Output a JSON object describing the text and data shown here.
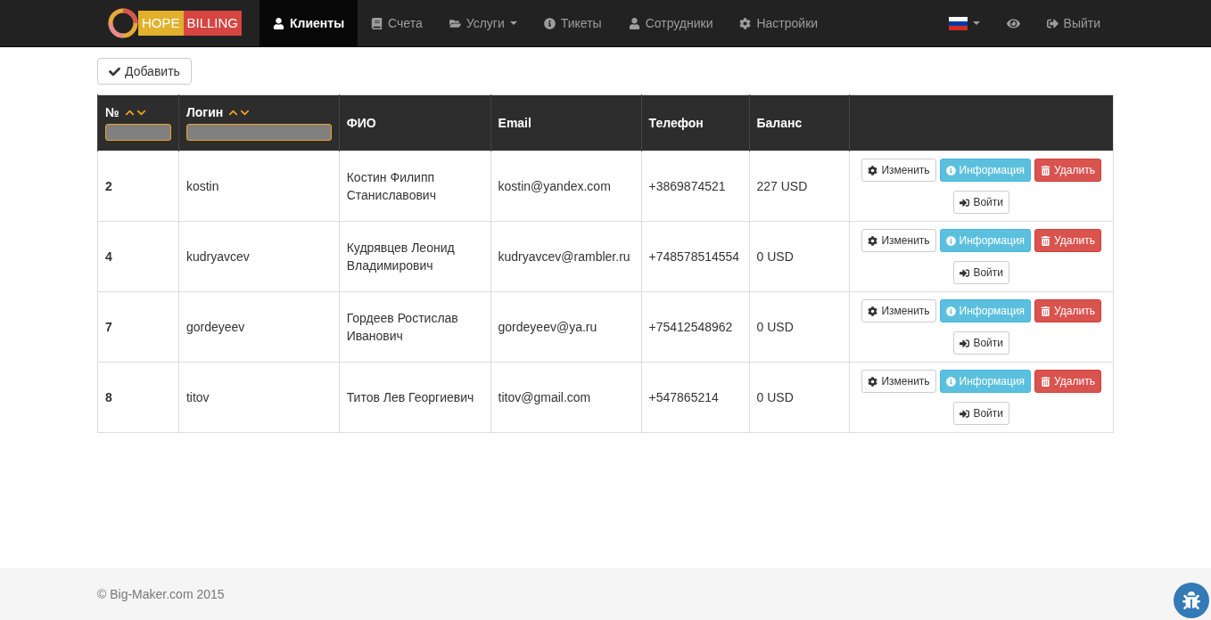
{
  "brand": {
    "left": "HOPE",
    "right": "BILLING"
  },
  "nav": [
    {
      "label": "Клиенты",
      "selected": true,
      "dropdown": false
    },
    {
      "label": "Счета",
      "selected": false,
      "dropdown": false
    },
    {
      "label": "Услуги",
      "selected": false,
      "dropdown": true
    },
    {
      "label": "Тикеты",
      "selected": false,
      "dropdown": false
    },
    {
      "label": "Сотрудники",
      "selected": false,
      "dropdown": false
    },
    {
      "label": "Настройки",
      "selected": false,
      "dropdown": false
    }
  ],
  "logout": "Выйти",
  "add_button": "Добавить",
  "table": {
    "columns": [
      {
        "label": "№",
        "sortable": true,
        "filter": true
      },
      {
        "label": "Логин",
        "sortable": true,
        "filter": true
      },
      {
        "label": "ФИО",
        "sortable": false,
        "filter": false
      },
      {
        "label": "Email",
        "sortable": false,
        "filter": false
      },
      {
        "label": "Телефон",
        "sortable": false,
        "filter": false
      },
      {
        "label": "Баланс",
        "sortable": false,
        "filter": false
      },
      {
        "sortable": false,
        "filter": false
      }
    ],
    "rows": [
      {
        "cells": [
          "2",
          "kostin",
          "Костин Филипп Станиславович",
          "kostin@yandex.com",
          "+3869874521",
          "227 USD"
        ],
        "actions": [
          {
            "kind": "edit",
            "label": "Изменить"
          },
          {
            "kind": "info",
            "label": "Информация"
          },
          {
            "kind": "delete",
            "label": "Удалить"
          },
          {
            "kind": "login",
            "label": "Войти"
          }
        ]
      },
      {
        "cells": [
          "4",
          "kudryavcev",
          "Кудрявцев Леонид Владимирович",
          "kudryavcev@rambler.ru",
          "+748578514554",
          "0 USD"
        ],
        "actions": [
          {
            "kind": "edit",
            "label": "Изменить"
          },
          {
            "kind": "info",
            "label": "Информация"
          },
          {
            "kind": "delete",
            "label": "Удалить"
          },
          {
            "kind": "login",
            "label": "Войти"
          }
        ]
      },
      {
        "cells": [
          "7",
          "gordeyeev",
          "Гордеев Ростислав Иванович",
          "gordeyeev@ya.ru",
          "+75412548962",
          "0 USD"
        ],
        "actions": [
          {
            "kind": "edit",
            "label": "Изменить"
          },
          {
            "kind": "info",
            "label": "Информация"
          },
          {
            "kind": "delete",
            "label": "Удалить"
          },
          {
            "kind": "login",
            "label": "Войти"
          }
        ]
      },
      {
        "cells": [
          "8",
          "titov",
          "Титов Лев Георгиевич",
          "titov@gmail.com",
          "+547865214",
          "0 USD"
        ],
        "actions": [
          {
            "kind": "edit",
            "label": "Изменить"
          },
          {
            "kind": "info",
            "label": "Информация"
          },
          {
            "kind": "delete",
            "label": "Удалить"
          },
          {
            "kind": "login",
            "label": "Войти"
          }
        ]
      }
    ]
  },
  "footer": "© Big-Maker.com 2015"
}
